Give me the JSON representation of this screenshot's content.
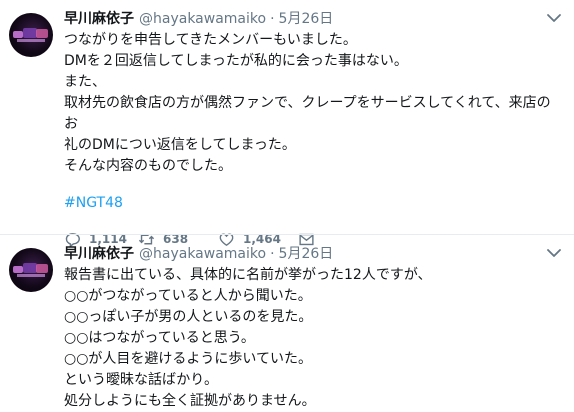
{
  "tweets": [
    {
      "name": "早川麻依子",
      "handle": "@hayakawamaiko",
      "separator": "·",
      "date": "5月26日",
      "lines": [
        "つながりを申告してきたメンバーもいました。",
        "DMを２回返信してしまったが私的に会った事はない。",
        "また、",
        "取材先の飲食店の方が偶然ファンで、クレープをサービスしてくれて、来店のお",
        "礼のDMについ返信をしてしまった。",
        "そんな内容のものでした。"
      ],
      "hashtag": "#NGT48",
      "replies": "1,114",
      "retweets": "638",
      "likes": "1,464"
    },
    {
      "name": "早川麻依子",
      "handle": "@hayakawamaiko",
      "separator": "·",
      "date": "5月26日",
      "lines": [
        "報告書に出ている、具体的に名前が挙がった12人ですが、",
        "○○がつながっていると人から聞いた。",
        "○○っぽい子が男の人といるのを見た。",
        "○○はつながっていると思う。",
        "○○が人目を避けるように歩いていた。",
        "という曖昧な話ばかり。",
        "処分しようにも全く証拠がありません。"
      ]
    }
  ],
  "icons": {
    "avatar": "profile-photo",
    "menu": "chevron-down-icon",
    "reply": "reply-icon",
    "retweet": "retweet-icon",
    "like": "heart-icon",
    "dm": "mail-icon"
  },
  "colors": {
    "link": "#1da1f2",
    "secondary": "#657786"
  }
}
